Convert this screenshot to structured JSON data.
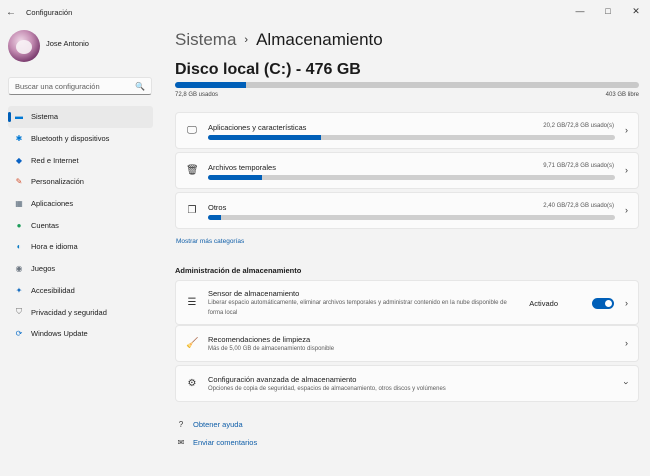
{
  "window": {
    "title": "Configuración",
    "back_icon": "←",
    "controls": {
      "minimize": "—",
      "maximize": "□",
      "close": "✕"
    }
  },
  "user": {
    "name": "Jose Antonio"
  },
  "search": {
    "placeholder": "Buscar una configuración",
    "icon": "🔍"
  },
  "sidebar": {
    "items": [
      {
        "label": "Sistema",
        "icon": "system-icon",
        "glyph": "▬",
        "color": "#0078d4",
        "active": true
      },
      {
        "label": "Bluetooth y dispositivos",
        "icon": "bluetooth-icon",
        "glyph": "✱",
        "color": "#0078d4",
        "active": false
      },
      {
        "label": "Red e Internet",
        "icon": "wifi-icon",
        "glyph": "◆",
        "color": "#0a62c4",
        "active": false
      },
      {
        "label": "Personalización",
        "icon": "brush-icon",
        "glyph": "✎",
        "color": "#d35230",
        "active": false
      },
      {
        "label": "Aplicaciones",
        "icon": "apps-icon",
        "glyph": "▦",
        "color": "#5a6b7b",
        "active": false
      },
      {
        "label": "Cuentas",
        "icon": "accounts-icon",
        "glyph": "●",
        "color": "#1d9c5a",
        "active": false
      },
      {
        "label": "Hora e idioma",
        "icon": "globe-clock-icon",
        "glyph": "◐",
        "color": "#0a7bc4",
        "active": false
      },
      {
        "label": "Juegos",
        "icon": "gamepad-icon",
        "glyph": "◉",
        "color": "#6b7580",
        "active": false
      },
      {
        "label": "Accesibilidad",
        "icon": "accessibility-icon",
        "glyph": "✦",
        "color": "#1a6fc1",
        "active": false
      },
      {
        "label": "Privacidad y seguridad",
        "icon": "shield-icon",
        "glyph": "⛉",
        "color": "#6c6c6c",
        "active": false
      },
      {
        "label": "Windows Update",
        "icon": "update-icon",
        "glyph": "⟳",
        "color": "#0a6ec9",
        "active": false
      }
    ]
  },
  "breadcrumb": {
    "parent": "Sistema",
    "separator": "›",
    "current": "Almacenamiento"
  },
  "disk": {
    "title": "Disco local (C:) - 476 GB",
    "used_label": "72,8 GB usados",
    "free_label": "403 GB libre",
    "used_fraction": 0.153
  },
  "categories": [
    {
      "title": "Aplicaciones y características",
      "value": "20,2 GB/72,8 GB usado(s)",
      "fraction": 0.277,
      "icon": "apps-features-icon",
      "glyph": "🖵"
    },
    {
      "title": "Archivos temporales",
      "value": "9,71 GB/72,8 GB usado(s)",
      "fraction": 0.133,
      "icon": "trash-icon",
      "glyph": "🗑"
    },
    {
      "title": "Otros",
      "value": "2,40 GB/72,8 GB usado(s)",
      "fraction": 0.033,
      "icon": "copy-icon",
      "glyph": "❐"
    }
  ],
  "more_categories": "Mostrar más categorías",
  "management": {
    "section_title": "Administración de almacenamiento",
    "sense": {
      "title": "Sensor de almacenamiento",
      "desc": "Liberar espacio automáticamente, eliminar archivos temporales y administrar contenido en la nube disponible de forma local",
      "state_label": "Activado",
      "icon": "storage-icon",
      "glyph": "☰"
    },
    "cleanup": {
      "title": "Recomendaciones de limpieza",
      "desc": "Más de 5,00 GB de almacenamiento disponible",
      "icon": "broom-icon",
      "glyph": "🧹"
    },
    "advanced": {
      "title": "Configuración avanzada de almacenamiento",
      "desc": "Opciones de copia de seguridad, espacios de almacenamiento, otros discos y volúmenes",
      "icon": "gear-icon",
      "glyph": "⚙"
    }
  },
  "help": {
    "get_help": "Obtener ayuda",
    "feedback": "Enviar comentarios",
    "help_glyph": "?",
    "feedback_glyph": "✉"
  },
  "colors": {
    "accent": "#005fb8",
    "link": "#0f5ea8",
    "bar_track": "#cfcfcf"
  }
}
